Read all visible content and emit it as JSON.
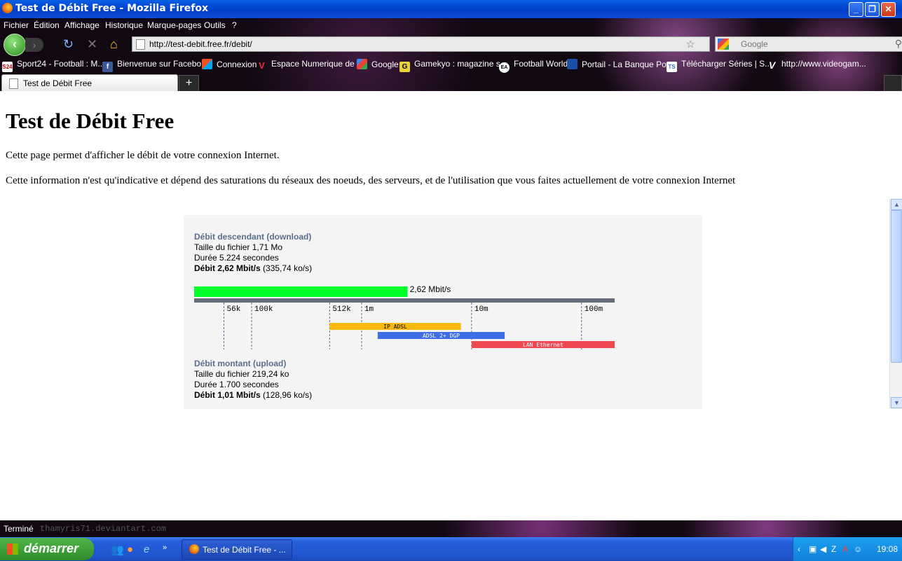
{
  "window": {
    "title": "Test de Débit Free - Mozilla Firefox"
  },
  "menu": [
    "Fichier",
    "Édition",
    "Affichage",
    "Historique",
    "Marque-pages",
    "Outils",
    "?"
  ],
  "nav": {
    "url": "http://test-debit.free.fr/debit/",
    "search_placeholder": "Google"
  },
  "bookmarks": [
    {
      "label": "Sport24 - Football : M...",
      "icon": "sport24-icon",
      "icon_text": "S24"
    },
    {
      "label": "Bienvenue sur Facebo...",
      "icon": "facebook-icon",
      "icon_text": "f"
    },
    {
      "label": "Connexion",
      "icon": "windows-live-icon",
      "icon_text": ""
    },
    {
      "label": "Espace Numerique de ...",
      "icon": "v-logo-icon",
      "icon_text": "V"
    },
    {
      "label": "Google",
      "icon": "google-icon",
      "icon_text": ""
    },
    {
      "label": "Gamekyo : magazine s...",
      "icon": "gamekyo-icon",
      "icon_text": "G"
    },
    {
      "label": "Football World",
      "icon": "ea-icon",
      "icon_text": "EA"
    },
    {
      "label": "Portail - La Banque Po...",
      "icon": "bank-icon",
      "icon_text": ""
    },
    {
      "label": "Télécharger Séries | S...",
      "icon": "ts-icon",
      "icon_text": "TS"
    },
    {
      "label": "http://www.videogam...",
      "icon": "videogame-icon",
      "icon_text": "V"
    }
  ],
  "tab": {
    "label": "Test de Débit Free",
    "new_tab": "+"
  },
  "page": {
    "title": "Test de Débit Free",
    "intro": "Cette page permet d'afficher le débit de votre connexion Internet.",
    "note": "Cette information n'est qu'indicative et dépend des saturations du réseaux des noeuds, des serveurs, et de l'utilisation que vous faites actuellement de votre connexion Internet"
  },
  "download": {
    "heading": "Débit descendant (download)",
    "size": "Taille du fichier 1,71 Mo",
    "duration": "Durée 5.224 secondes",
    "rate_bold": "Débit 2,62 Mbit/s",
    "rate_extra": "(335,74 ko/s)"
  },
  "upload": {
    "heading": "Débit montant (upload)",
    "size": "Taille du fichier 219,24 ko",
    "duration": "Durée 1.700 secondes",
    "rate_bold": "Débit 1,01 Mbit/s",
    "rate_extra": "(128,96 ko/s)"
  },
  "speed_gauge": {
    "value_mbit": 2.62,
    "value_label": "2,62 Mbit/s",
    "bar_color": "#00ff2a",
    "scale_min_kbit": 30,
    "scale_max_kbit": 200000,
    "ticks": [
      {
        "label": "56k",
        "kbit": 56
      },
      {
        "label": "100k",
        "kbit": 100
      },
      {
        "label": "512k",
        "kbit": 512
      },
      {
        "label": "1m",
        "kbit": 1000
      },
      {
        "label": "10m",
        "kbit": 10000
      },
      {
        "label": "100m",
        "kbit": 100000
      }
    ],
    "ranges": [
      {
        "label": "IP ADSL",
        "from_kbit": 512,
        "to_kbit": 8000,
        "color": "#f9b90f"
      },
      {
        "label": "ADSL 2+ DGP",
        "from_kbit": 1400,
        "to_kbit": 20000,
        "color": "#3d6ee8"
      },
      {
        "label": "LAN Ethernet",
        "from_kbit": 10000,
        "to_kbit": 200000,
        "color": "#f04850"
      }
    ]
  },
  "status": {
    "text": "Terminé",
    "watermark": "thamyris71.deviantart.com"
  },
  "taskbar": {
    "start": "démarrer",
    "task": "Test de Débit Free - ...",
    "clock": "19:08"
  }
}
